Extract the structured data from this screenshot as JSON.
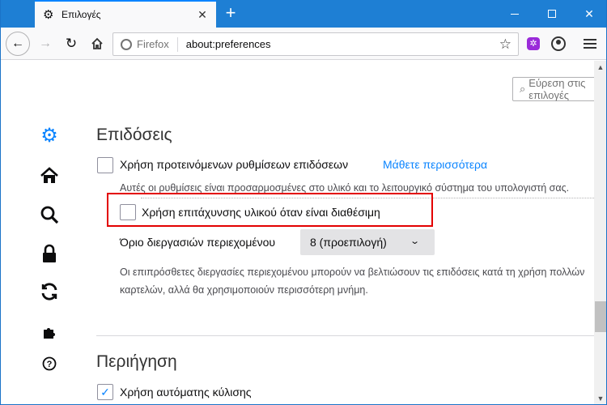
{
  "tab": {
    "title": "Επιλογές",
    "close": "✕"
  },
  "newtab": "+",
  "urlbar": {
    "brand": "Firefox",
    "url": "about:preferences"
  },
  "search": {
    "placeholder": "Εύρεση στις επιλογές"
  },
  "performance": {
    "title": "Επιδόσεις",
    "recommended_label": "Χρήση προτεινόμενων ρυθμίσεων επιδόσεων",
    "learn_more": "Μάθετε περισσότερα",
    "recommended_desc": "Αυτές οι ρυθμίσεις είναι προσαρμοσμένες στο υλικό και το λειτουργικό σύστημα του υπολογιστή σας.",
    "hw_accel_label": "Χρήση επιτάχυνσης υλικού όταν είναι διαθέσιμη",
    "process_limit_label": "Όριο διεργασιών περιεχομένου",
    "process_limit_value": "8 (προεπιλογή)",
    "process_desc_line1": "Οι επιπρόσθετες διεργασίες περιεχομένου μπορούν να βελτιώσουν τις επιδόσεις κατά τη χρήση πολλών",
    "process_desc_line2": "καρτελών, αλλά θα χρησιμοποιούν περισσότερη μνήμη."
  },
  "browsing": {
    "title": "Περιήγηση",
    "first_label": "Χρήση αυτόματης κύλισης"
  },
  "colors": {
    "accent": "#0a84ff",
    "highlight": "#e30000",
    "titlebar": "#1e7fd4"
  }
}
